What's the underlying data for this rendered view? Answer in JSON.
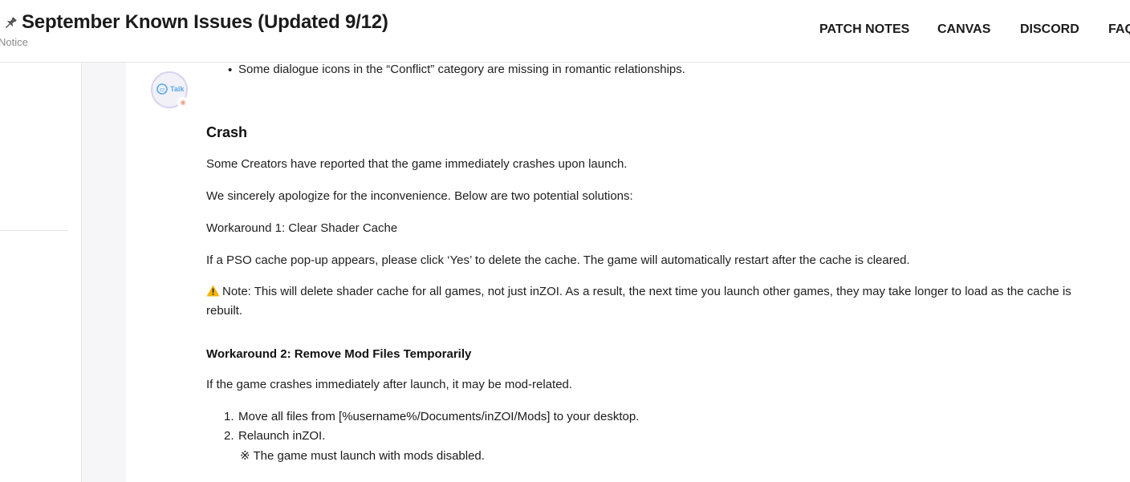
{
  "header": {
    "title": "September Known Issues (Updated 9/12)",
    "category": "Notice",
    "nav": [
      "PATCH NOTES",
      "CANVAS",
      "DISCORD",
      "FAQ"
    ]
  },
  "author": {
    "avatar_text": "Talk"
  },
  "content": {
    "bullet_item": "Some dialogue icons in the “Conflict” category are missing in romantic relationships.",
    "crash_heading": "Crash",
    "p1": "Some Creators have reported that the game immediately crashes upon launch.",
    "p2": "We sincerely apologize for the inconvenience. Below are two potential solutions:",
    "workaround1": "Workaround 1: Clear Shader Cache",
    "p3": "If a PSO cache pop-up appears, please click ‘Yes’ to delete the cache. The game will automatically restart after the cache is cleared.",
    "note": "Note: This will delete shader cache for all games, not just inZOI. As a result, the next time you launch other games, they may take longer to load as the cache is rebuilt.",
    "workaround2": "Workaround 2: Remove Mod Files Temporarily",
    "p4": "If the game crashes immediately after launch, it may be mod-related.",
    "steps": [
      {
        "num": "1.",
        "text": "Move all files from [%username%/Documents/inZOI/Mods] to your desktop."
      },
      {
        "num": "2.",
        "text": "Relaunch inZOI."
      }
    ],
    "step_note": "※ The game must launch with mods disabled."
  },
  "colors": {
    "accent_avatar": "#5aa9e8",
    "warning": "#f5b400"
  },
  "icons": [
    "pin-icon",
    "warning-icon",
    "paw-icon"
  ]
}
